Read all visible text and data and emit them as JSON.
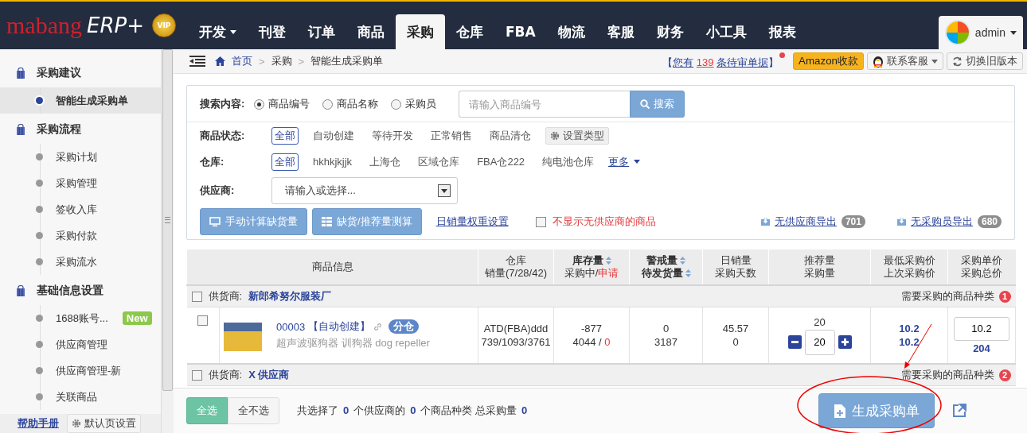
{
  "app": {
    "logo_text": "mabang",
    "logo_suffix": "ERP+",
    "vip_badge": "VIP"
  },
  "nav": [
    {
      "label": "开发",
      "dropdown": true,
      "selected": false
    },
    {
      "label": "刊登",
      "dropdown": false,
      "selected": false
    },
    {
      "label": "订单",
      "dropdown": false,
      "selected": false
    },
    {
      "label": "商品",
      "dropdown": false,
      "selected": false
    },
    {
      "label": "采购",
      "dropdown": false,
      "selected": true
    },
    {
      "label": "仓库",
      "dropdown": false,
      "selected": false
    },
    {
      "label": "FBA",
      "dropdown": false,
      "selected": false
    },
    {
      "label": "物流",
      "dropdown": false,
      "selected": false
    },
    {
      "label": "客服",
      "dropdown": false,
      "selected": false
    },
    {
      "label": "财务",
      "dropdown": false,
      "selected": false
    },
    {
      "label": "小工具",
      "dropdown": false,
      "selected": false
    },
    {
      "label": "报表",
      "dropdown": false,
      "selected": false
    }
  ],
  "user": {
    "name": "admin"
  },
  "breadcrumb": {
    "separator": ">",
    "items": [
      "首页",
      "采购",
      "智能生成采购单"
    ]
  },
  "notice": {
    "open": "【",
    "before": "您有",
    "count": "139",
    "after": "条待审单据",
    "close": "】",
    "unread": true
  },
  "top_buttons": [
    {
      "kind": "amazon",
      "label": "Amazon收款"
    },
    {
      "kind": "contact",
      "label": "联系客服"
    },
    {
      "kind": "switch",
      "label": "切换旧版本"
    }
  ],
  "sidebar": {
    "groups": [
      {
        "label": "采购建议",
        "children": [
          {
            "label": "智能生成采购单",
            "selected": true
          }
        ]
      },
      {
        "label": "采购流程",
        "children": [
          {
            "label": "采购计划",
            "selected": false
          },
          {
            "label": "采购管理",
            "selected": false
          },
          {
            "label": "签收入库",
            "selected": false
          },
          {
            "label": "采购付款",
            "selected": false
          },
          {
            "label": "采购流水",
            "selected": false
          }
        ]
      },
      {
        "label": "基础信息设置",
        "children": [
          {
            "label": "1688账号...",
            "badge": "New",
            "selected": false
          },
          {
            "label": "供应商管理",
            "selected": false
          },
          {
            "label": "供应商管理-新",
            "selected": false
          },
          {
            "label": "关联商品",
            "selected": false
          }
        ]
      }
    ],
    "help_link": "帮助手册",
    "default_page_button": "默认页设置"
  },
  "search": {
    "label": "搜索内容:",
    "options": [
      {
        "label": "商品编号",
        "selected": true
      },
      {
        "label": "商品名称",
        "selected": false
      },
      {
        "label": "采购员",
        "selected": false
      }
    ],
    "placeholder": "请输入商品编号",
    "button": "搜索"
  },
  "filters": [
    {
      "kind": "status",
      "label": "商品状态:",
      "options": [
        {
          "label": "全部",
          "selected": true
        },
        {
          "label": "自动创建",
          "selected": false
        },
        {
          "label": "等待开发",
          "selected": false
        },
        {
          "label": "正常销售",
          "selected": false
        },
        {
          "label": "商品清仓",
          "selected": false
        }
      ],
      "settings_button": "设置类型"
    },
    {
      "kind": "warehouse",
      "label": "仓库:",
      "options": [
        {
          "label": "全部",
          "selected": true
        },
        {
          "label": "hkhkjkjjk",
          "selected": false
        },
        {
          "label": "上海仓",
          "selected": false
        },
        {
          "label": "区域仓库",
          "selected": false
        },
        {
          "label": "FBA仓222",
          "selected": false
        },
        {
          "label": "纯电池仓库",
          "selected": false
        }
      ],
      "more_link": "更多"
    }
  ],
  "supplier_filter": {
    "label": "供应商:",
    "placeholder": "请输入或选择..."
  },
  "actions": {
    "buttons": [
      {
        "kind": "monitor",
        "label": "手动计算缺货量"
      },
      {
        "kind": "grid",
        "label": "缺货/推荐量测算"
      }
    ],
    "weight_link": "日销量权重设置",
    "hide_no_supplier": {
      "label": "不显示无供应商的商品",
      "checked": false
    },
    "exports": [
      {
        "label": "无供应商导出",
        "count": "701"
      },
      {
        "label": "无采购员导出",
        "count": "680"
      }
    ]
  },
  "table": {
    "columns": [
      {
        "lines": [
          {
            "text": "商品信息",
            "sortable": false
          }
        ]
      },
      {
        "lines": [
          {
            "text": "仓库",
            "sortable": false
          },
          {
            "text": "销量(7/28/42)",
            "sortable": false
          }
        ]
      },
      {
        "lines": [
          {
            "text": "库存量",
            "sortable": true
          },
          {
            "text": "采购中/",
            "alert_text": "申请",
            "sortable": false
          }
        ]
      },
      {
        "lines": [
          {
            "text": "警戒量",
            "sortable": true
          },
          {
            "text": "待发货量",
            "sortable": true
          }
        ]
      },
      {
        "lines": [
          {
            "text": "日销量",
            "sortable": false
          },
          {
            "text": "采购天数",
            "sortable": false
          }
        ]
      },
      {
        "lines": [
          {
            "text": "推荐量",
            "sortable": false
          },
          {
            "text": "采购量",
            "sortable": false
          }
        ]
      },
      {
        "lines": [
          {
            "text": "最低采购价",
            "sortable": false
          },
          {
            "text": "上次采购价",
            "sortable": false
          }
        ]
      },
      {
        "lines": [
          {
            "text": "采购单价",
            "sortable": false
          },
          {
            "text": "采购总价",
            "sortable": false
          }
        ]
      }
    ],
    "groups": [
      {
        "supplier_label": "供货商:",
        "supplier": "新郎希努尔服装厂",
        "checked": false,
        "kinds_label": "需要采购的商品种类",
        "kinds_count": "1",
        "rows": [
          {
            "checked": false,
            "code": "00003",
            "tag": "【自动创建】",
            "badge": "分仓",
            "name": "超声波驱狗器 训狗器 dog repeller",
            "warehouse": "ATD(FBA)ddd",
            "sales": "739/1093/3761",
            "stock": "-877",
            "purchasing": "4044",
            "separator": "/",
            "applying": "0",
            "alert_qty": "0",
            "pending_ship": "3187",
            "daily_sales": "45.57",
            "purchase_days": "0",
            "recommended": "20",
            "quantity": "20",
            "lowest_price": "10.2",
            "last_price": "10.2",
            "unit_price": "10.2",
            "total_price": "204"
          }
        ]
      },
      {
        "supplier_label": "供货商:",
        "supplier": "X 供应商",
        "checked": false,
        "kinds_label": "需要采购的商品种类",
        "kinds_count": "2"
      }
    ]
  },
  "footer": {
    "select_buttons": [
      {
        "label": "全选",
        "selected": true
      },
      {
        "label": "全不选",
        "selected": false
      }
    ],
    "summary": [
      "共选择了",
      "0",
      "个供应商的",
      "0",
      "个商品种类 总采购量",
      "0"
    ],
    "generate_button": "生成采购单"
  }
}
